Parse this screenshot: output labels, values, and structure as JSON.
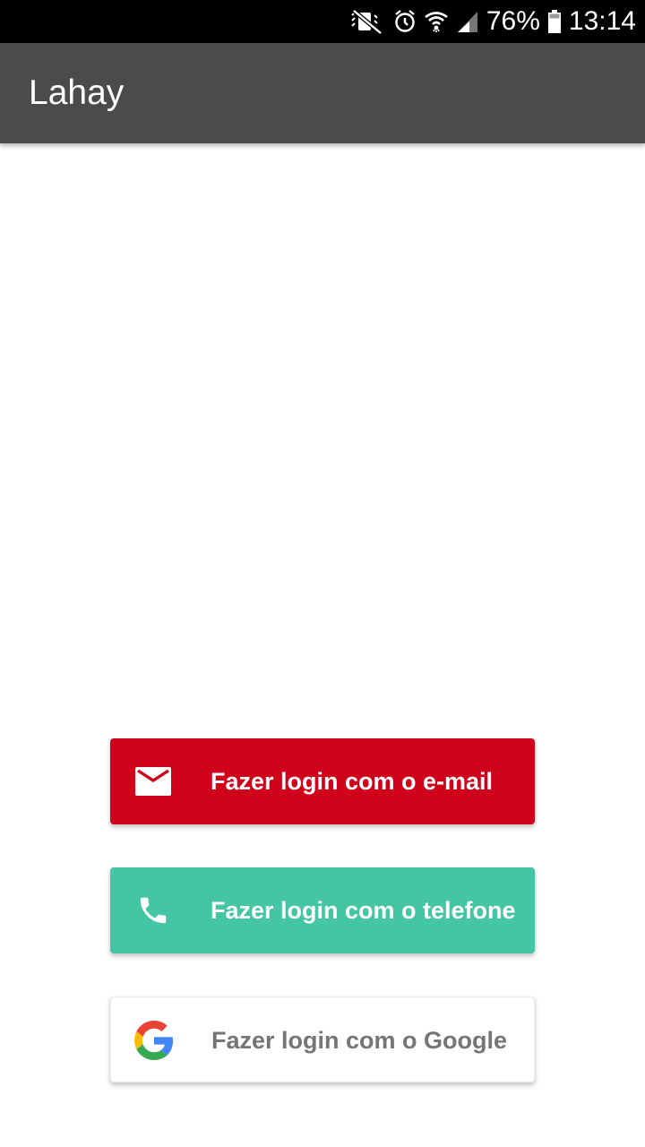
{
  "status_bar": {
    "battery": "76%",
    "time": "13:14",
    "icons": [
      "vibrate-mute-icon",
      "alarm-icon",
      "wifi-icon",
      "signal-icon",
      "battery-icon"
    ]
  },
  "app_bar": {
    "title": "Lahay",
    "background": "#4b4b4b"
  },
  "login": {
    "email": {
      "label": "Fazer login com o e-mail",
      "icon": "mail-icon",
      "background": "#d0021b",
      "text_color": "#ffffff"
    },
    "phone": {
      "label": "Fazer login com o telefone",
      "icon": "phone-icon",
      "background": "#44c6a4",
      "text_color": "#ffffff"
    },
    "google": {
      "label": "Fazer login com o Google",
      "icon": "google-icon",
      "background": "#ffffff",
      "text_color": "#757575"
    }
  }
}
